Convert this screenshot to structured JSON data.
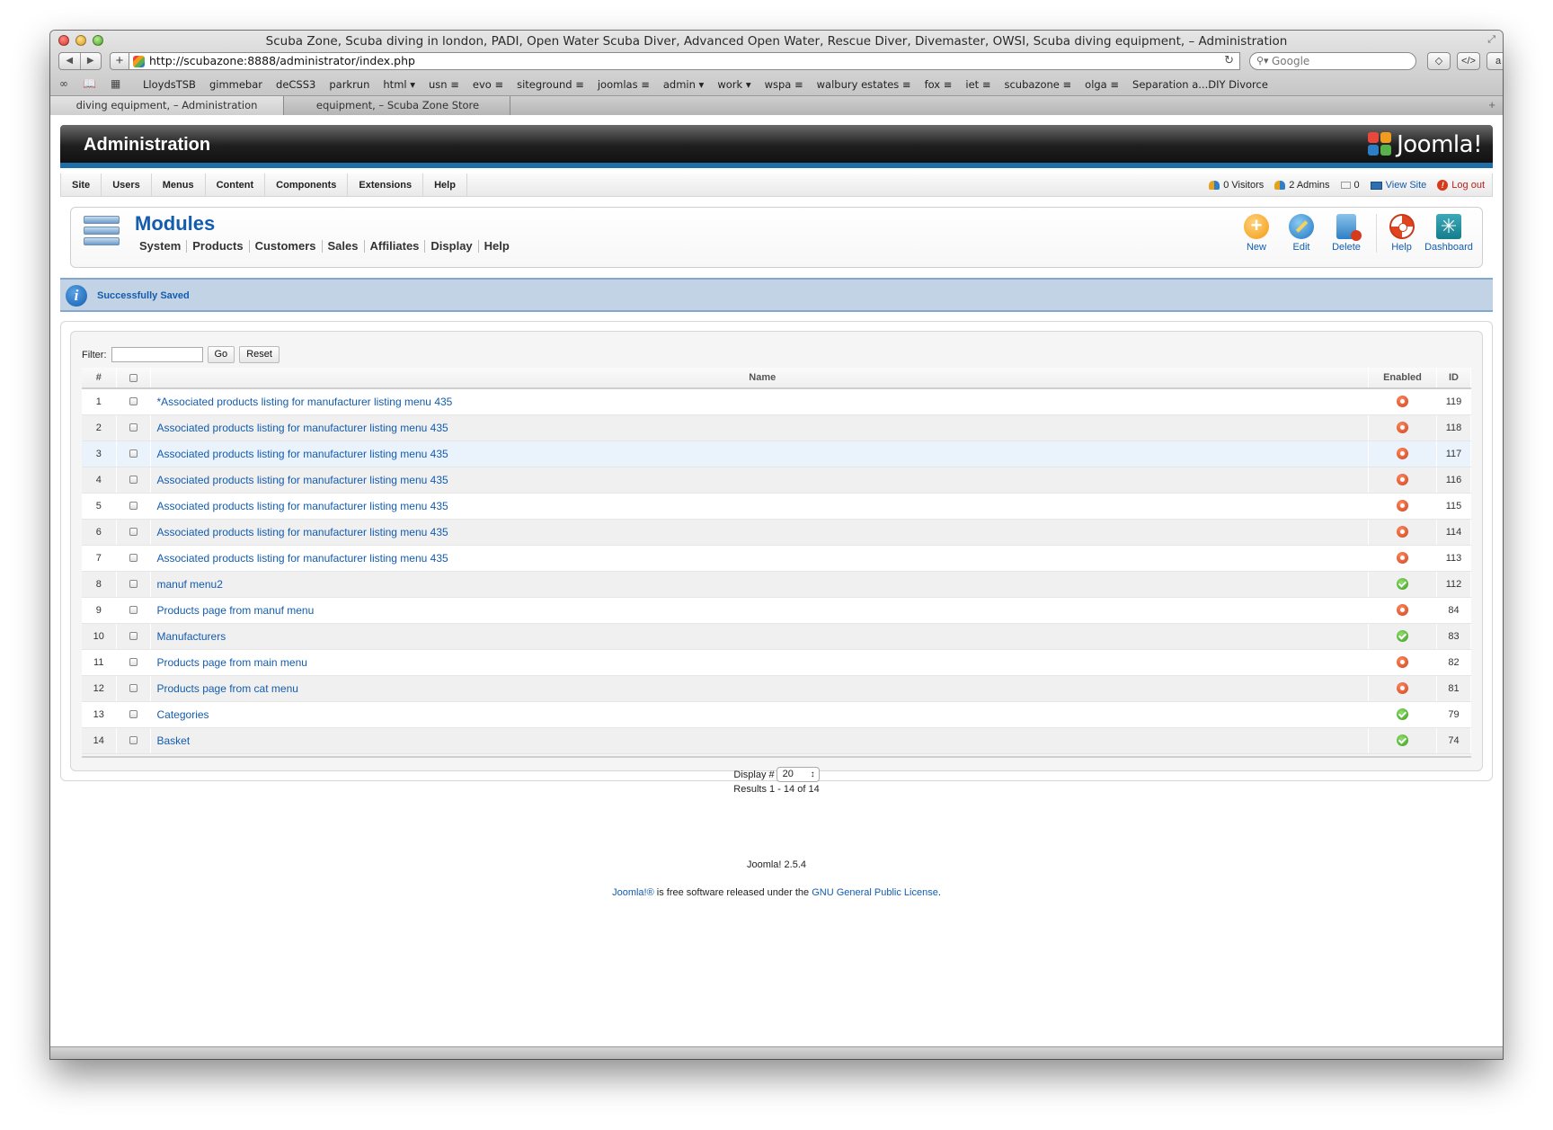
{
  "browser": {
    "window_title": "Scuba Zone, Scuba diving in london, PADI, Open Water Scuba Diver, Advanced Open Water, Rescue Diver, Divemaster, OWSI, Scuba diving equipment, – Administration",
    "url": "http://scubazone:8888/administrator/index.php",
    "search_placeholder": "Google",
    "bookmarks": [
      "LloydsTSB",
      "gimmebar",
      "deCSS3",
      "parkrun",
      "html ▾",
      "usn ≡",
      "evo ≡",
      "siteground ≡",
      "joomlas ≡",
      "admin ▾",
      "work ▾",
      "wspa ≡",
      "walbury estates ≡",
      "fox ≡",
      "iet ≡",
      "scubazone ≡",
      "olga ≡",
      "Separation a...DIY Divorce"
    ],
    "tabs": [
      "diving equipment, – Administration",
      "equipment, – Scuba Zone Store"
    ]
  },
  "header": {
    "title": "Administration",
    "logo_text": "Joomla!"
  },
  "menu": {
    "items": [
      "Site",
      "Users",
      "Menus",
      "Content",
      "Components",
      "Extensions",
      "Help"
    ],
    "status": {
      "visitors": "0 Visitors",
      "admins": "2 Admins",
      "messages": "0",
      "view_site": "View Site",
      "logout": "Log out"
    }
  },
  "toolbar": {
    "heading": "Modules",
    "submenu": [
      "System",
      "Products",
      "Customers",
      "Sales",
      "Affiliates",
      "Display",
      "Help"
    ],
    "actions": {
      "new": "New",
      "edit": "Edit",
      "delete": "Delete",
      "help": "Help",
      "dashboard": "Dashboard"
    }
  },
  "message": "Successfully Saved",
  "filter": {
    "label": "Filter:",
    "value": "",
    "go": "Go",
    "reset": "Reset"
  },
  "table": {
    "headers": {
      "num": "#",
      "name": "Name",
      "enabled": "Enabled",
      "id": "ID"
    },
    "rows": [
      {
        "num": "1",
        "name": "*Associated products listing for manufacturer listing menu 435",
        "enabled": false,
        "id": "119"
      },
      {
        "num": "2",
        "name": "Associated products listing for manufacturer listing menu 435",
        "enabled": false,
        "id": "118"
      },
      {
        "num": "3",
        "name": "Associated products listing for manufacturer listing menu 435",
        "enabled": false,
        "id": "117"
      },
      {
        "num": "4",
        "name": "Associated products listing for manufacturer listing menu 435",
        "enabled": false,
        "id": "116"
      },
      {
        "num": "5",
        "name": "Associated products listing for manufacturer listing menu 435",
        "enabled": false,
        "id": "115"
      },
      {
        "num": "6",
        "name": "Associated products listing for manufacturer listing menu 435",
        "enabled": false,
        "id": "114"
      },
      {
        "num": "7",
        "name": "Associated products listing for manufacturer listing menu 435",
        "enabled": false,
        "id": "113"
      },
      {
        "num": "8",
        "name": "manuf menu2",
        "enabled": true,
        "id": "112"
      },
      {
        "num": "9",
        "name": "Products page from manuf menu",
        "enabled": false,
        "id": "84"
      },
      {
        "num": "10",
        "name": "Manufacturers",
        "enabled": true,
        "id": "83"
      },
      {
        "num": "11",
        "name": "Products page from main menu",
        "enabled": false,
        "id": "82"
      },
      {
        "num": "12",
        "name": "Products page from cat menu",
        "enabled": false,
        "id": "81"
      },
      {
        "num": "13",
        "name": "Categories",
        "enabled": true,
        "id": "79"
      },
      {
        "num": "14",
        "name": "Basket",
        "enabled": true,
        "id": "74"
      }
    ]
  },
  "pagination": {
    "display_label": "Display #",
    "display_value": "20",
    "results": "Results 1 - 14 of 14"
  },
  "footer": {
    "version": "Joomla! 2.5.4",
    "license_prefix": "Joomla!®",
    "license_middle": " is free software released under the ",
    "license_link": "GNU General Public License",
    "license_suffix": "."
  },
  "colors": {
    "accent": "#135cae",
    "header_bar": "#1c6fa8",
    "message_bg": "#c3d3e6",
    "disabled_status": "#d0411a",
    "enabled_status": "#3b9a1f"
  }
}
